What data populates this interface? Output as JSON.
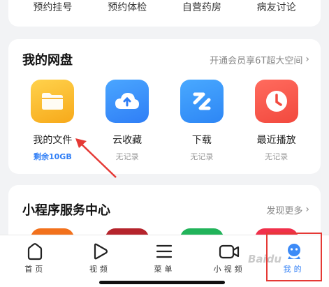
{
  "top_services": [
    "预约挂号",
    "预约体检",
    "自营药房",
    "病友讨论"
  ],
  "netdisk": {
    "title": "我的网盘",
    "promo": "开通会员享6T超大空间",
    "items": [
      {
        "label": "我的文件",
        "sub": "剩余10GB",
        "icon": "folder-icon",
        "color": "#f7a91a"
      },
      {
        "label": "云收藏",
        "sub": "无记录",
        "icon": "cloud-upload-icon",
        "color": "#2f7ef6"
      },
      {
        "label": "下载",
        "sub": "无记录",
        "icon": "download-icon",
        "color": "#2d86f5"
      },
      {
        "label": "最近播放",
        "sub": "无记录",
        "icon": "clock-icon",
        "color": "#f2493e"
      }
    ]
  },
  "mini_programs": {
    "title": "小程序服务中心",
    "more": "发现更多"
  },
  "bottom_nav": [
    {
      "label": "首页",
      "icon": "home-icon"
    },
    {
      "label": "视频",
      "icon": "play-icon"
    },
    {
      "label": "菜单",
      "icon": "menu-icon"
    },
    {
      "label": "小视频",
      "icon": "camera-icon"
    },
    {
      "label": "我的",
      "icon": "profile-icon",
      "active": true
    }
  ],
  "watermark": "Baidu",
  "colors": {
    "accent": "#2f7ef6",
    "annotation": "#e53935"
  }
}
